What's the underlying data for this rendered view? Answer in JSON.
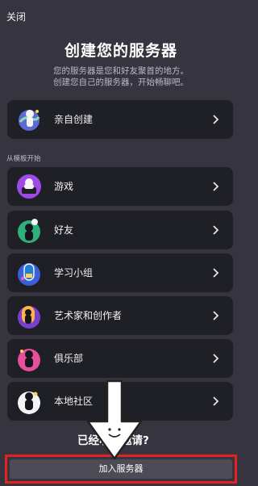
{
  "header": {
    "close_label": "关闭"
  },
  "title": "创建您的服务器",
  "subtitle_line1": "您的服务器是您和好友聚首的地方。",
  "subtitle_line2": "创建您自己的服务器，开始畅聊吧。",
  "create_own": {
    "label": "亲自创建",
    "icon": "globe-person-icon"
  },
  "templates_section_label": "从模板开始",
  "templates": [
    {
      "label": "游戏",
      "icon": "gaming-icon"
    },
    {
      "label": "好友",
      "icon": "friends-icon"
    },
    {
      "label": "学习小组",
      "icon": "study-group-icon"
    },
    {
      "label": "艺术家和创作者",
      "icon": "artists-icon"
    },
    {
      "label": "俱乐部",
      "icon": "club-icon"
    },
    {
      "label": "本地社区",
      "icon": "local-community-icon"
    }
  ],
  "invite_prompt": "已经收到邀请?",
  "join_button_label": "加入服务器",
  "colors": {
    "background": "#35343f",
    "card": "#1f1f26",
    "highlight": "#e52222"
  }
}
